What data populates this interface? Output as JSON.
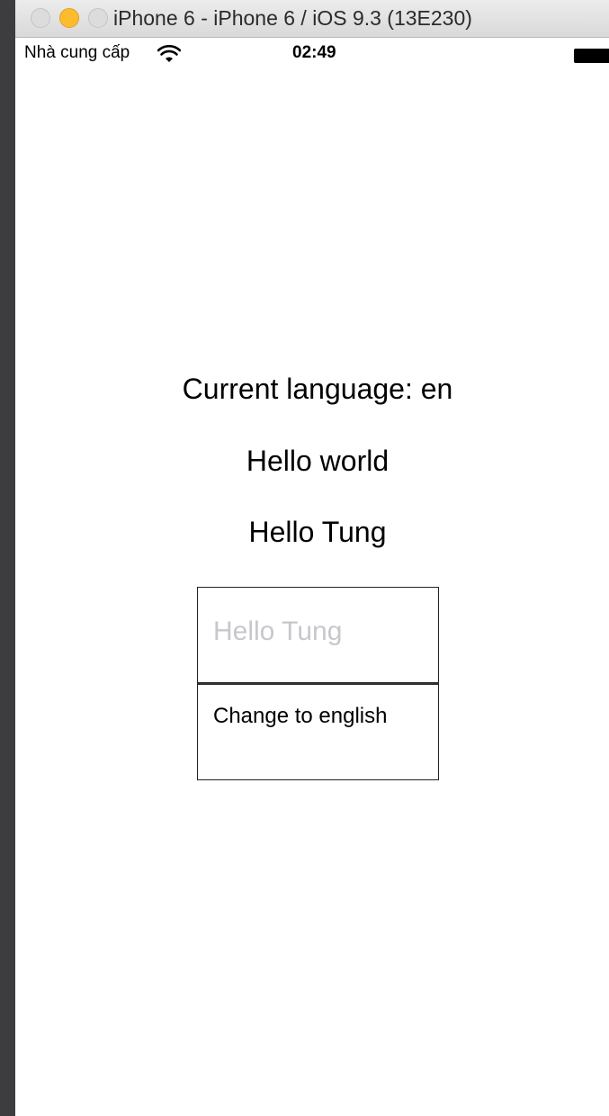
{
  "window": {
    "title": "iPhone 6 - iPhone 6 / iOS 9.3 (13E230)"
  },
  "status_bar": {
    "carrier": "Nhà cung cấp",
    "time": "02:49",
    "icons": [
      "wifi-icon",
      "battery-icon"
    ]
  },
  "main": {
    "current_language_label": "Current language: en",
    "hello_world_label": "Hello world",
    "hello_tung_label": "Hello Tung",
    "text_field": {
      "placeholder": "Hello Tung",
      "value": ""
    },
    "change_button_label": "Change to english"
  },
  "colors": {
    "traffic_minimize": "#fdbc2e",
    "placeholder": "#c7c7cd",
    "background": "#ffffff"
  }
}
